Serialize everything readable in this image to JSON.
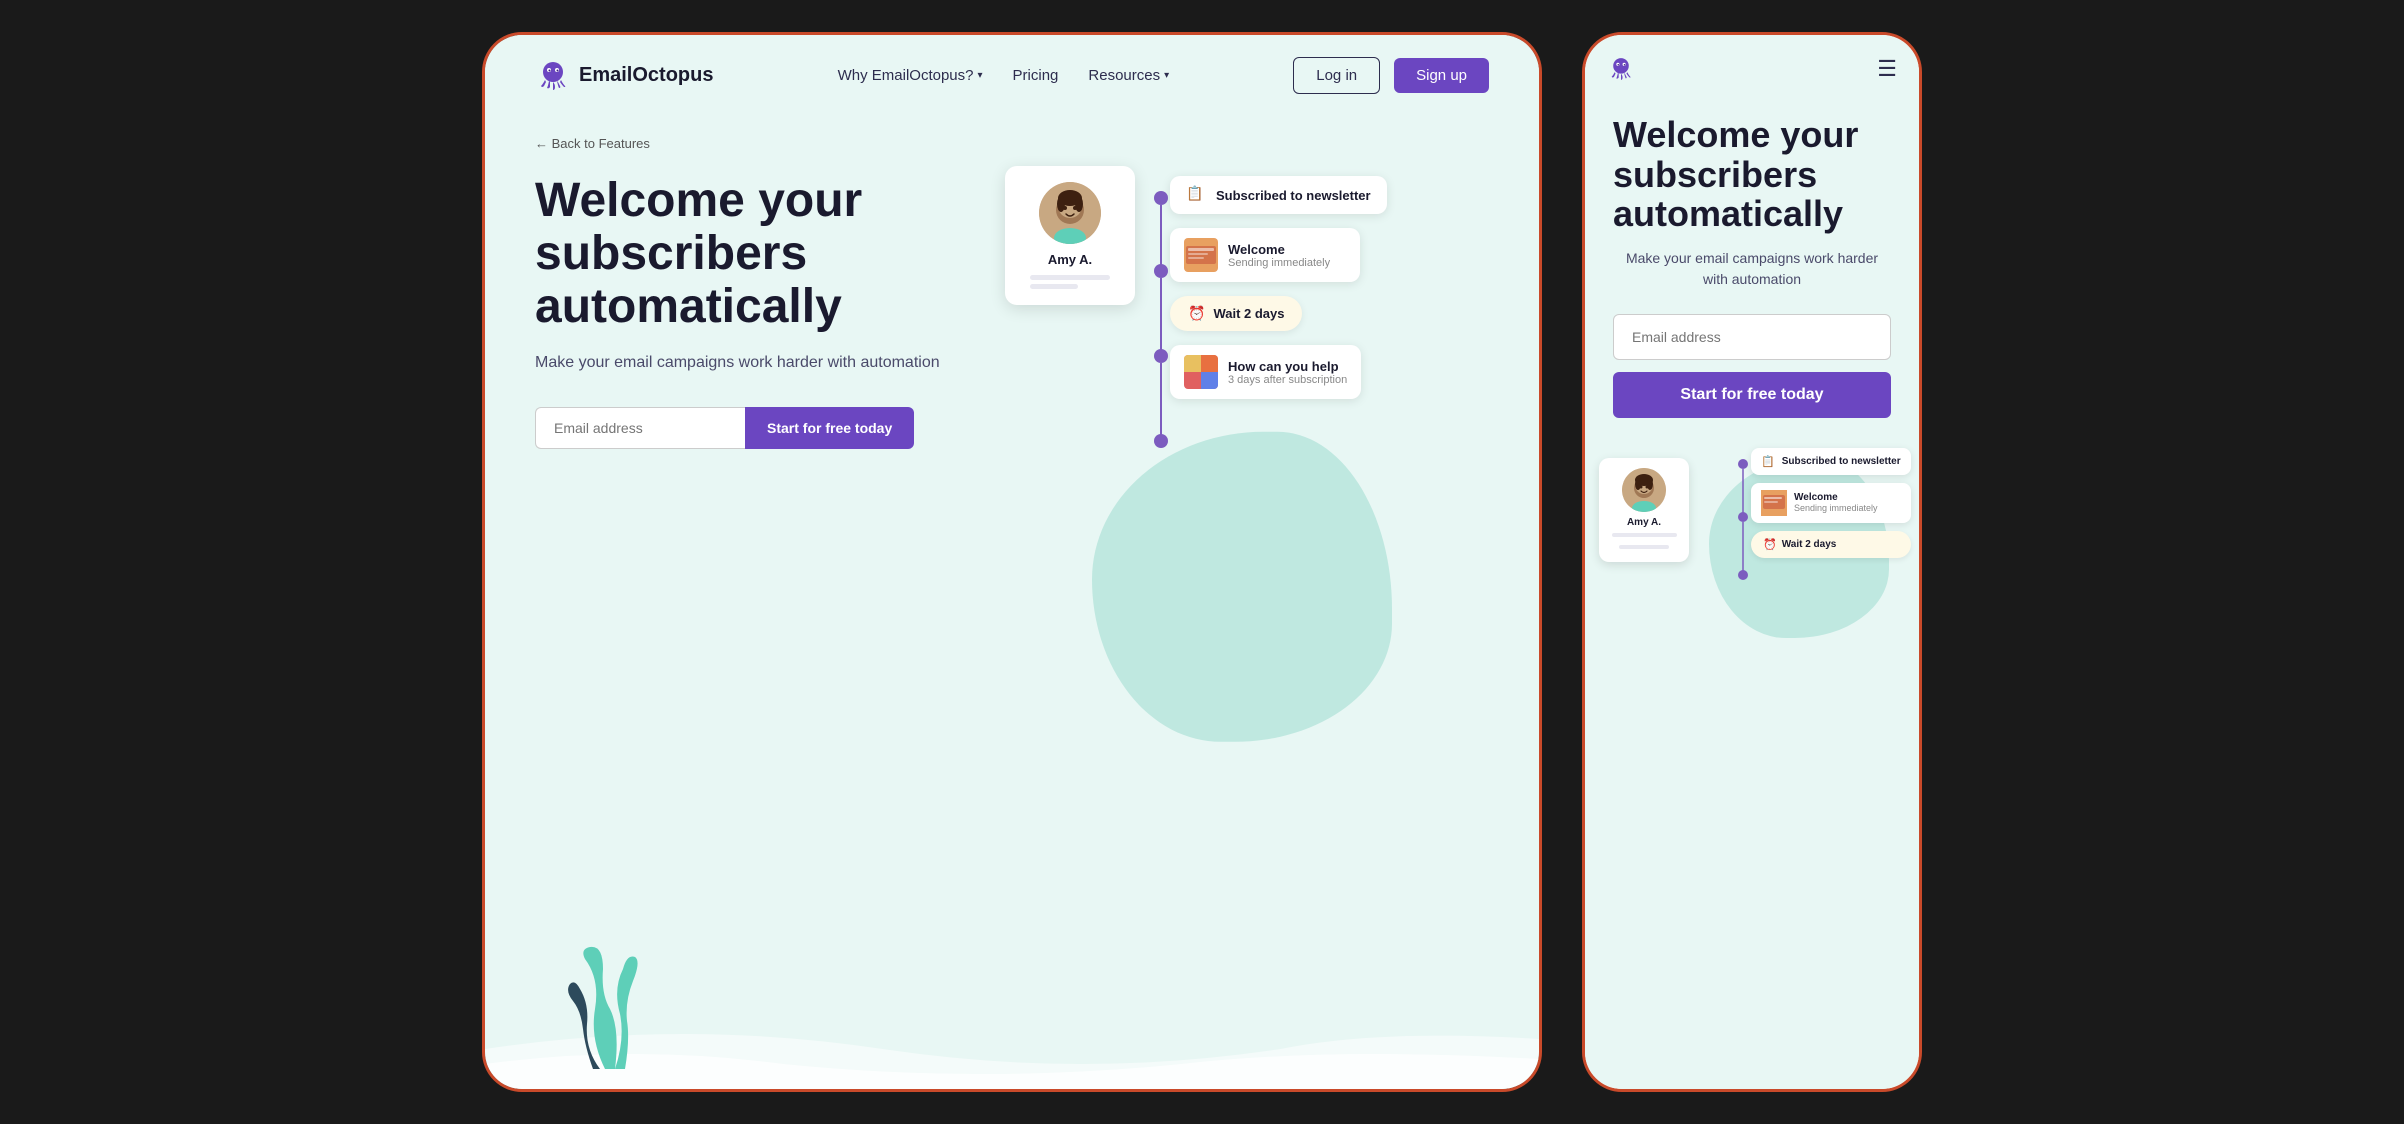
{
  "brand": {
    "name": "EmailOctopus",
    "logo_color": "#6b46c1"
  },
  "navbar": {
    "why_label": "Why EmailOctopus?",
    "pricing_label": "Pricing",
    "resources_label": "Resources",
    "login_label": "Log in",
    "signup_label": "Sign up"
  },
  "breadcrumb": {
    "label": "← Back to Features"
  },
  "hero": {
    "title": "Welcome your subscribers automatically",
    "subtitle": "Make your email campaigns work harder with automation",
    "email_placeholder": "Email address",
    "cta_label": "Start for free today"
  },
  "automation": {
    "amy_name": "Amy A.",
    "steps": [
      {
        "type": "trigger",
        "icon": "doc",
        "label": "Subscribed to newsletter"
      },
      {
        "type": "email",
        "title": "Welcome",
        "subtitle": "Sending immediately",
        "has_image": true
      },
      {
        "type": "wait",
        "label": "Wait 2 days"
      },
      {
        "type": "email",
        "title": "How can you help",
        "subtitle": "3 days after subscription",
        "has_image": true
      }
    ]
  },
  "mobile": {
    "hero_title": "Welcome your subscribers automatically",
    "hero_subtitle": "Make your email campaigns work harder with automation",
    "email_placeholder": "Email address",
    "cta_label": "Start for free today",
    "amy_name": "Amy A.",
    "steps": [
      {
        "type": "trigger",
        "label": "Subscribed to newsletter"
      },
      {
        "type": "email",
        "title": "Welcome",
        "subtitle": "Sending immediately"
      },
      {
        "type": "wait",
        "label": "Wait 2 days"
      }
    ]
  }
}
